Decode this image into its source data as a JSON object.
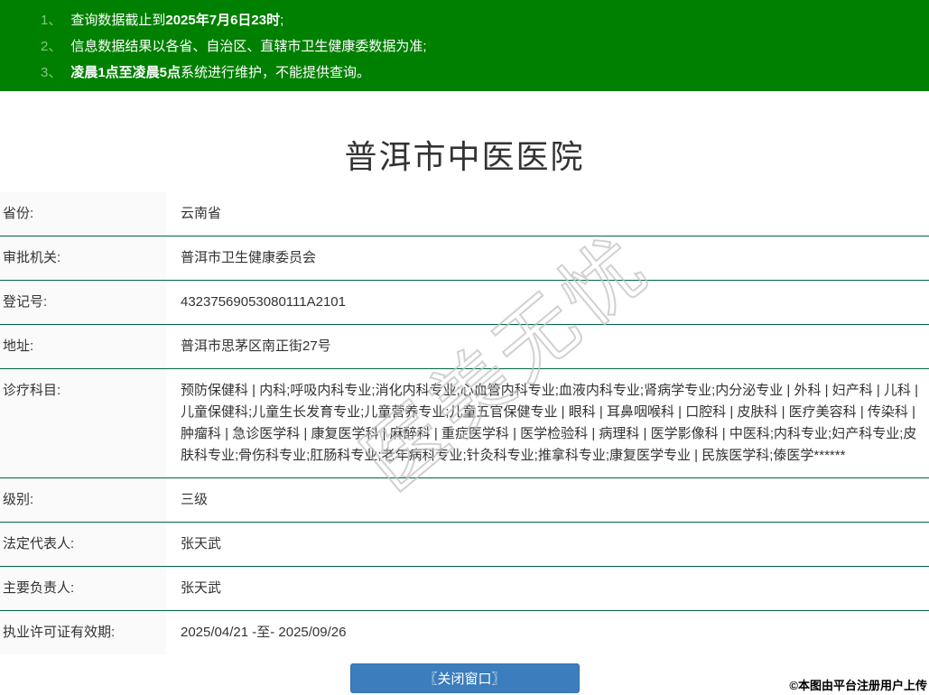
{
  "notices": {
    "lines": [
      {
        "num": "1、",
        "pre": "查询数据截止到",
        "strong": "2025年7月6日23时",
        "post": ";"
      },
      {
        "num": "2、",
        "pre": "信息数据结果以各省、自治区、直辖市卫生健康委数据为准;",
        "strong": "",
        "post": ""
      },
      {
        "num": "3、",
        "pre": "",
        "strong": "凌晨1点至凌晨5点",
        "post": "系统进行维护，不能提供查询。"
      }
    ]
  },
  "title": "普洱市中医医院",
  "fields": [
    {
      "label": "省份:",
      "value": "云南省"
    },
    {
      "label": "审批机关:",
      "value": "普洱市卫生健康委员会"
    },
    {
      "label": "登记号:",
      "value": "43237569053080111A2101"
    },
    {
      "label": "地址:",
      "value": "普洱市思茅区南正街27号"
    },
    {
      "label": "诊疗科目:",
      "value": "预防保健科 | 内科;呼吸内科专业;消化内科专业;心血管内科专业;血液内科专业;肾病学专业;内分泌专业 | 外科 | 妇产科 | 儿科 | 儿童保健科;儿童生长发育专业;儿童营养专业;儿童五官保健专业 | 眼科 | 耳鼻咽喉科 | 口腔科 | 皮肤科 | 医疗美容科 | 传染科 | 肿瘤科 | 急诊医学科 | 康复医学科 | 麻醉科 | 重症医学科 | 医学检验科 | 病理科 | 医学影像科 | 中医科;内科专业;妇产科专业;皮肤科专业;骨伤科专业;肛肠科专业;老年病科专业;针灸科专业;推拿科专业;康复医学专业 | 民族医学科;傣医学******"
    },
    {
      "label": "级别:",
      "value": "三级"
    },
    {
      "label": "法定代表人:",
      "value": "张天武"
    },
    {
      "label": "主要负责人:",
      "value": "张天武"
    },
    {
      "label": "执业许可证有效期:",
      "value": "2025/04/21 -至- 2025/09/26"
    }
  ],
  "watermark": "医美无忧",
  "close_button_label": "〖关闭窗口〗",
  "attribution": "©本图由平台注册用户上传",
  "colors": {
    "banner_green": "#008000",
    "notice_number_green": "#7ec97e",
    "divider_green": "#006644",
    "label_cell_bg": "#fafafa",
    "button_blue": "#3b7dbd",
    "text": "#333333"
  }
}
